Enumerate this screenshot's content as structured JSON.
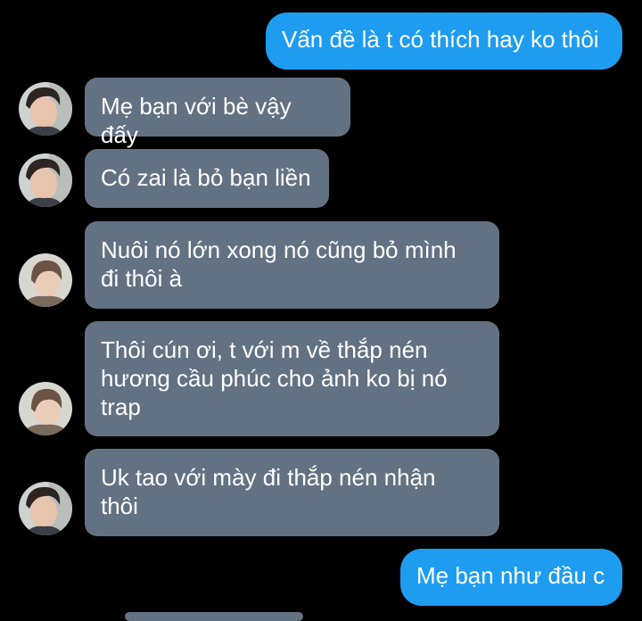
{
  "messages": [
    {
      "direction": "outgoing",
      "text": "Vấn đề là t có thích hay ko thôi"
    },
    {
      "direction": "incoming",
      "avatar": "avatar-photo-a",
      "text": "Mẹ bạn với bè vậy đấy"
    },
    {
      "direction": "incoming",
      "avatar": "avatar-photo-a",
      "text": "Có zai là bỏ bạn liền"
    },
    {
      "direction": "incoming",
      "avatar": "avatar-photo-b",
      "text": "Nuôi nó lớn xong nó cũng bỏ mình\nđi thôi à"
    },
    {
      "direction": "incoming",
      "avatar": "avatar-photo-b",
      "text": "Thôi cún ơi, t với m về thắp nén\nhương cầu phúc cho ảnh ko bị nó\ntrap"
    },
    {
      "direction": "incoming",
      "avatar": "avatar-photo-a",
      "text": "Uk tao với mày đi thắp nén nhận\nthôi"
    },
    {
      "direction": "outgoing",
      "text": "Mẹ bạn như đầu c"
    }
  ],
  "colors": {
    "background": "#000000",
    "outgoing_bubble": "#1e9cf0",
    "incoming_bubble": "#637282",
    "text": "#ffffff"
  }
}
